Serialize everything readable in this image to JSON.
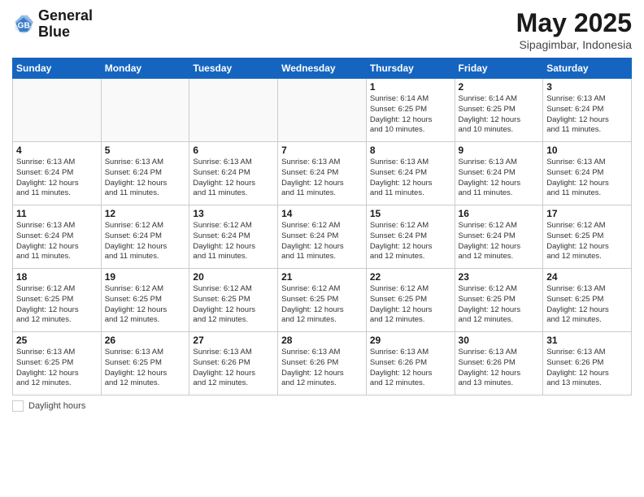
{
  "logo": {
    "line1": "General",
    "line2": "Blue"
  },
  "header": {
    "month_year": "May 2025",
    "location": "Sipagimbar, Indonesia"
  },
  "days_of_week": [
    "Sunday",
    "Monday",
    "Tuesday",
    "Wednesday",
    "Thursday",
    "Friday",
    "Saturday"
  ],
  "footer": {
    "label": "Daylight hours"
  },
  "weeks": [
    [
      {
        "day": "",
        "info": ""
      },
      {
        "day": "",
        "info": ""
      },
      {
        "day": "",
        "info": ""
      },
      {
        "day": "",
        "info": ""
      },
      {
        "day": "1",
        "info": "Sunrise: 6:14 AM\nSunset: 6:25 PM\nDaylight: 12 hours\nand 10 minutes."
      },
      {
        "day": "2",
        "info": "Sunrise: 6:14 AM\nSunset: 6:25 PM\nDaylight: 12 hours\nand 10 minutes."
      },
      {
        "day": "3",
        "info": "Sunrise: 6:13 AM\nSunset: 6:24 PM\nDaylight: 12 hours\nand 11 minutes."
      }
    ],
    [
      {
        "day": "4",
        "info": "Sunrise: 6:13 AM\nSunset: 6:24 PM\nDaylight: 12 hours\nand 11 minutes."
      },
      {
        "day": "5",
        "info": "Sunrise: 6:13 AM\nSunset: 6:24 PM\nDaylight: 12 hours\nand 11 minutes."
      },
      {
        "day": "6",
        "info": "Sunrise: 6:13 AM\nSunset: 6:24 PM\nDaylight: 12 hours\nand 11 minutes."
      },
      {
        "day": "7",
        "info": "Sunrise: 6:13 AM\nSunset: 6:24 PM\nDaylight: 12 hours\nand 11 minutes."
      },
      {
        "day": "8",
        "info": "Sunrise: 6:13 AM\nSunset: 6:24 PM\nDaylight: 12 hours\nand 11 minutes."
      },
      {
        "day": "9",
        "info": "Sunrise: 6:13 AM\nSunset: 6:24 PM\nDaylight: 12 hours\nand 11 minutes."
      },
      {
        "day": "10",
        "info": "Sunrise: 6:13 AM\nSunset: 6:24 PM\nDaylight: 12 hours\nand 11 minutes."
      }
    ],
    [
      {
        "day": "11",
        "info": "Sunrise: 6:13 AM\nSunset: 6:24 PM\nDaylight: 12 hours\nand 11 minutes."
      },
      {
        "day": "12",
        "info": "Sunrise: 6:12 AM\nSunset: 6:24 PM\nDaylight: 12 hours\nand 11 minutes."
      },
      {
        "day": "13",
        "info": "Sunrise: 6:12 AM\nSunset: 6:24 PM\nDaylight: 12 hours\nand 11 minutes."
      },
      {
        "day": "14",
        "info": "Sunrise: 6:12 AM\nSunset: 6:24 PM\nDaylight: 12 hours\nand 11 minutes."
      },
      {
        "day": "15",
        "info": "Sunrise: 6:12 AM\nSunset: 6:24 PM\nDaylight: 12 hours\nand 12 minutes."
      },
      {
        "day": "16",
        "info": "Sunrise: 6:12 AM\nSunset: 6:24 PM\nDaylight: 12 hours\nand 12 minutes."
      },
      {
        "day": "17",
        "info": "Sunrise: 6:12 AM\nSunset: 6:25 PM\nDaylight: 12 hours\nand 12 minutes."
      }
    ],
    [
      {
        "day": "18",
        "info": "Sunrise: 6:12 AM\nSunset: 6:25 PM\nDaylight: 12 hours\nand 12 minutes."
      },
      {
        "day": "19",
        "info": "Sunrise: 6:12 AM\nSunset: 6:25 PM\nDaylight: 12 hours\nand 12 minutes."
      },
      {
        "day": "20",
        "info": "Sunrise: 6:12 AM\nSunset: 6:25 PM\nDaylight: 12 hours\nand 12 minutes."
      },
      {
        "day": "21",
        "info": "Sunrise: 6:12 AM\nSunset: 6:25 PM\nDaylight: 12 hours\nand 12 minutes."
      },
      {
        "day": "22",
        "info": "Sunrise: 6:12 AM\nSunset: 6:25 PM\nDaylight: 12 hours\nand 12 minutes."
      },
      {
        "day": "23",
        "info": "Sunrise: 6:12 AM\nSunset: 6:25 PM\nDaylight: 12 hours\nand 12 minutes."
      },
      {
        "day": "24",
        "info": "Sunrise: 6:13 AM\nSunset: 6:25 PM\nDaylight: 12 hours\nand 12 minutes."
      }
    ],
    [
      {
        "day": "25",
        "info": "Sunrise: 6:13 AM\nSunset: 6:25 PM\nDaylight: 12 hours\nand 12 minutes."
      },
      {
        "day": "26",
        "info": "Sunrise: 6:13 AM\nSunset: 6:25 PM\nDaylight: 12 hours\nand 12 minutes."
      },
      {
        "day": "27",
        "info": "Sunrise: 6:13 AM\nSunset: 6:26 PM\nDaylight: 12 hours\nand 12 minutes."
      },
      {
        "day": "28",
        "info": "Sunrise: 6:13 AM\nSunset: 6:26 PM\nDaylight: 12 hours\nand 12 minutes."
      },
      {
        "day": "29",
        "info": "Sunrise: 6:13 AM\nSunset: 6:26 PM\nDaylight: 12 hours\nand 12 minutes."
      },
      {
        "day": "30",
        "info": "Sunrise: 6:13 AM\nSunset: 6:26 PM\nDaylight: 12 hours\nand 13 minutes."
      },
      {
        "day": "31",
        "info": "Sunrise: 6:13 AM\nSunset: 6:26 PM\nDaylight: 12 hours\nand 13 minutes."
      }
    ]
  ]
}
